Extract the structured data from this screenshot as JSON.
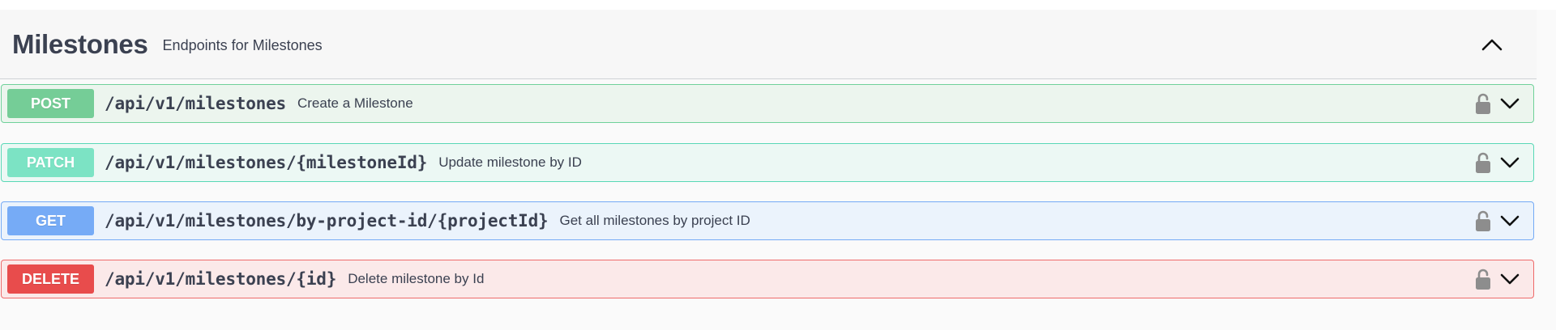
{
  "tag": {
    "title": "Milestones",
    "description": "Endpoints for Milestones"
  },
  "operations": [
    {
      "method": "POST",
      "path": "/api/v1/milestones",
      "summary": "Create a Milestone"
    },
    {
      "method": "PATCH",
      "path": "/api/v1/milestones/{milestoneId}",
      "summary": "Update milestone by ID"
    },
    {
      "method": "GET",
      "path": "/api/v1/milestones/by-project-id/{projectId}",
      "summary": "Get all milestones by project ID"
    },
    {
      "method": "DELETE",
      "path": "/api/v1/milestones/{id}",
      "summary": "Delete milestone by Id"
    }
  ],
  "colors": {
    "post": "#75cd97",
    "patch": "#7ce3c4",
    "get": "#76abf6",
    "delete": "#e84c4c"
  },
  "icons": {
    "collapse": "chevron-up-icon",
    "lock": "lock-icon",
    "expand": "chevron-down-icon"
  }
}
